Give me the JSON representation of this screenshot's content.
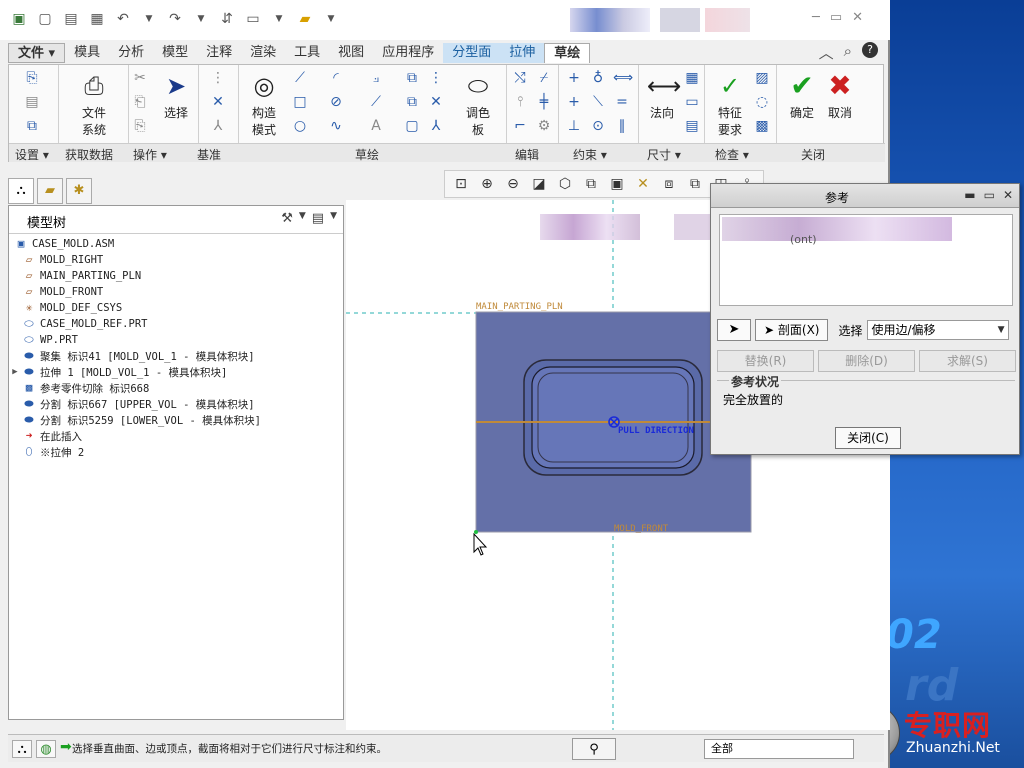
{
  "menubar": {
    "file": "文件",
    "items": [
      "模具",
      "分析",
      "模型",
      "注释",
      "渲染",
      "工具",
      "视图",
      "应用程序"
    ],
    "parting_surface": "分型面",
    "extrude": "拉伸",
    "sketch": "草绘"
  },
  "ribbon": {
    "file_system": "文件\n系统",
    "select": "选择",
    "construction_mode": "构造\n模式",
    "palette": "调色\n板",
    "normal": "法向",
    "feature_requirements": "特征\n要求",
    "ok": "确定",
    "cancel": "取消",
    "groups": {
      "settings": "设置",
      "get_data": "获取数据",
      "operations": "操作",
      "datum": "基准",
      "sketch": "草绘",
      "edit": "编辑",
      "constrain": "约束",
      "dimension": "尺寸",
      "inspect": "检查",
      "close": "关闭"
    }
  },
  "tree": {
    "title": "模型树",
    "items": [
      {
        "label": "CASE_MOLD.ASM",
        "icon": "assembly-icon"
      },
      {
        "label": "MOLD_RIGHT",
        "icon": "datum-plane-icon"
      },
      {
        "label": "MAIN_PARTING_PLN",
        "icon": "datum-plane-icon"
      },
      {
        "label": "MOLD_FRONT",
        "icon": "datum-plane-icon"
      },
      {
        "label": "MOLD_DEF_CSYS",
        "icon": "csys-icon"
      },
      {
        "label": "CASE_MOLD_REF.PRT",
        "icon": "part-icon"
      },
      {
        "label": "WP.PRT",
        "icon": "part-icon"
      },
      {
        "label": "聚集 标识41 [MOLD_VOL_1 - 模具体积块]",
        "icon": "volume-icon"
      },
      {
        "label": "拉伸 1 [MOLD_VOL_1 - 模具体积块]",
        "icon": "volume-icon",
        "expandable": true
      },
      {
        "label": "参考零件切除 标识668",
        "icon": "cut-icon"
      },
      {
        "label": "分割 标识667 [UPPER_VOL - 模具体积块]",
        "icon": "volume-icon"
      },
      {
        "label": "分割 标识5259 [LOWER_VOL - 模具体积块]",
        "icon": "volume-icon"
      },
      {
        "label": "在此插入",
        "icon": "insert-arrow-icon"
      },
      {
        "label": "※拉伸 2",
        "icon": "extrude-icon"
      }
    ]
  },
  "canvas": {
    "plane_label": "MAIN_PARTING_PLN",
    "pull_direction": "PULL DIRECTION",
    "bottom_label": "MOLD_FRONT"
  },
  "dialog": {
    "title": "参考",
    "list_item": "(ont)",
    "section_button": "剖面(X)",
    "select_label": "选择",
    "select_value": "使用边/偏移",
    "replace": "替换(R)",
    "delete": "删除(D)",
    "solve": "求解(S)",
    "status_legend": "参考状况",
    "status_value": "完全放置的",
    "close": "关闭(C)"
  },
  "status": {
    "message": "选择垂直曲面、边或顶点，截面将相对于它们进行尺寸标注和约束。",
    "filter": "全部"
  },
  "desktop": {
    "number": "02",
    "watermark_cn": "专职网",
    "watermark_en": "Zhuanzhi.Net"
  },
  "colors": {
    "part_fill": "#6470a8",
    "plane_line": "#c08a3a",
    "pull_direction": "#1a2ad8",
    "ok_green": "#1aa020",
    "cancel_red": "#cc2020"
  }
}
